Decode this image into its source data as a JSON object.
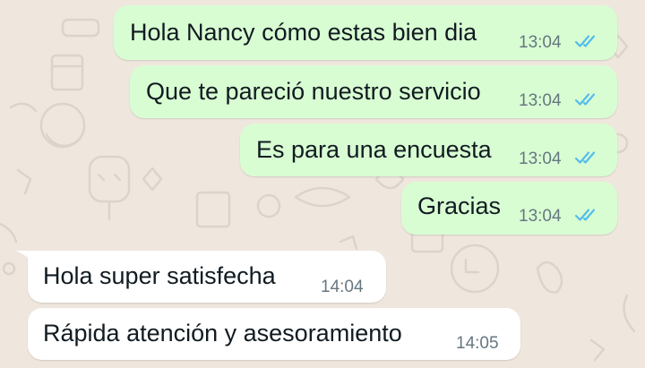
{
  "chat": {
    "messages": [
      {
        "direction": "outgoing",
        "text": "Hola Nancy cómo estas bien dia",
        "time": "13:04",
        "status_icon": "double-check-read-icon"
      },
      {
        "direction": "outgoing",
        "text": "Que te pareció nuestro servicio",
        "time": "13:04",
        "status_icon": "double-check-read-icon"
      },
      {
        "direction": "outgoing",
        "text": "Es para una encuesta",
        "time": "13:04",
        "status_icon": "double-check-read-icon"
      },
      {
        "direction": "outgoing",
        "text": "Gracias",
        "time": "13:04",
        "status_icon": "double-check-read-icon"
      },
      {
        "direction": "incoming",
        "text": "Hola super satisfecha",
        "time": "14:04"
      },
      {
        "direction": "incoming",
        "text": "Rápida atención y asesoramiento",
        "time": "14:05"
      }
    ]
  },
  "colors": {
    "wallpaper": "#efe7de",
    "outgoing_bubble": "#d9fdd3",
    "incoming_bubble": "#ffffff",
    "read_ticks": "#53bdeb",
    "time_text": "#667781",
    "message_text": "#111b21"
  }
}
